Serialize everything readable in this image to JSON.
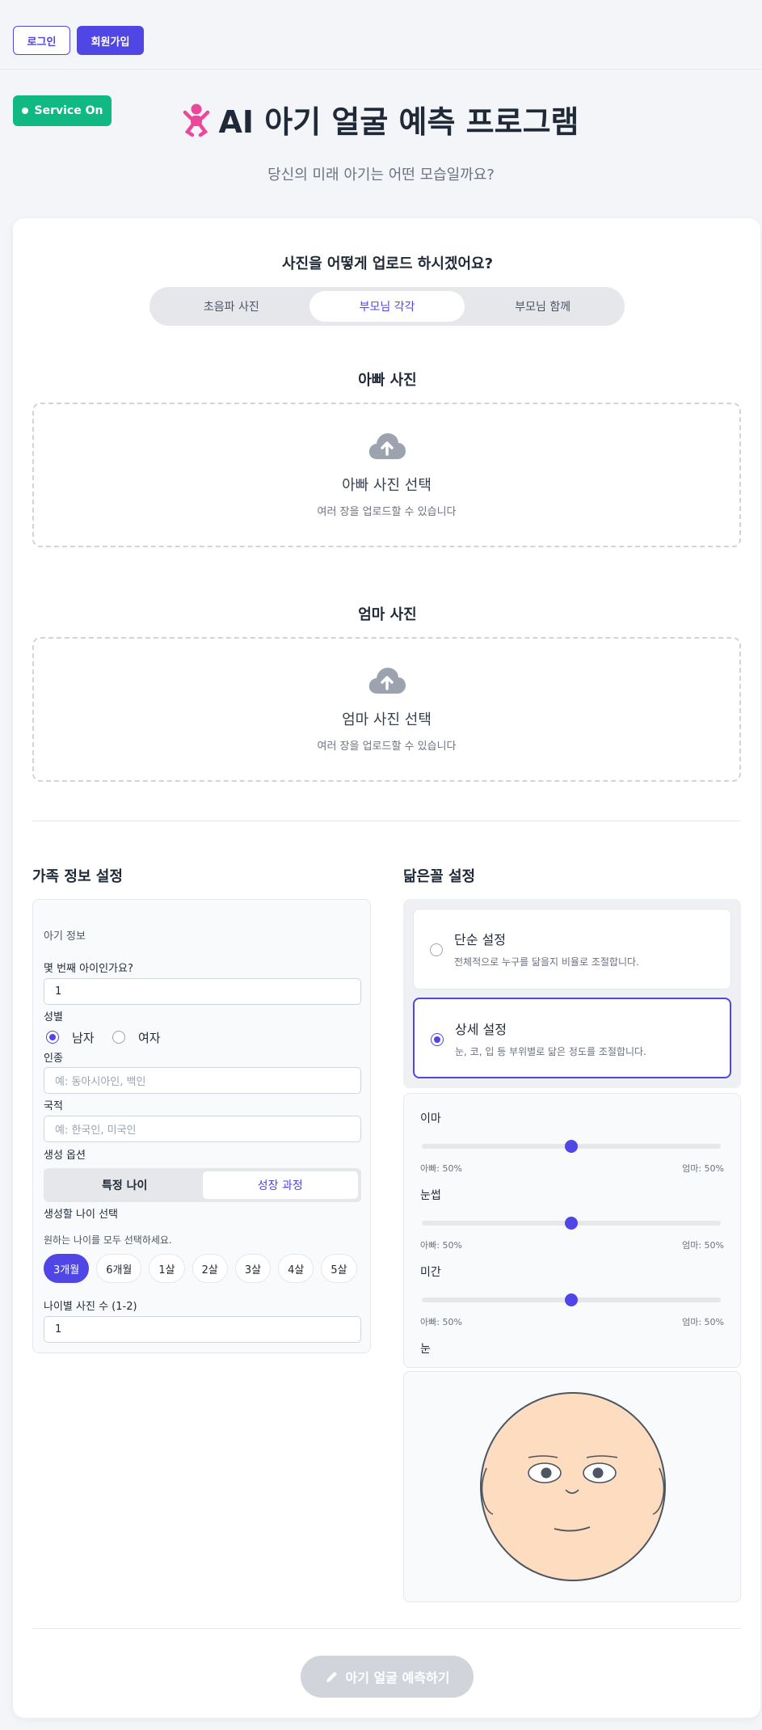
{
  "header": {
    "login_label": "로그인",
    "signup_label": "회원가입"
  },
  "service_status": "Service On",
  "title": "AI 아기 얼굴 예측 프로그램",
  "subtitle": "당신의 미래 아기는 어떤 모습일까요?",
  "upload": {
    "question": "사진을 어떻게 업로드 하시겠어요?",
    "tabs": [
      {
        "label": "초음파 사진",
        "active": false
      },
      {
        "label": "부모님 각각",
        "active": true
      },
      {
        "label": "부모님 함께",
        "active": false
      }
    ],
    "father": {
      "heading": "아빠 사진",
      "title": "아빠 사진 선택",
      "hint": "여러 장을 업로드할 수 있습니다"
    },
    "mother": {
      "heading": "엄마 사진",
      "title": "엄마 사진 선택",
      "hint": "여러 장을 업로드할 수 있습니다"
    }
  },
  "family": {
    "heading": "가족 정보 설정",
    "baby_info_label": "아기 정보",
    "birth_order_label": "몇 번째 아이인가요?",
    "birth_order_value": "1",
    "gender_label": "성별",
    "gender_options": [
      {
        "label": "남자",
        "selected": true
      },
      {
        "label": "여자",
        "selected": false
      }
    ],
    "ethnicity_label": "인종",
    "ethnicity_placeholder": "예: 동아시아인, 백인",
    "nationality_label": "국적",
    "nationality_placeholder": "예: 한국인, 미국인",
    "generation_label": "생성 옵션",
    "generation_options": [
      {
        "label": "특정 나이",
        "active": false
      },
      {
        "label": "성장 과정",
        "active": true
      }
    ],
    "age_select_label": "생성할 나이 선택",
    "age_select_hint": "원하는 나이를 모두 선택하세요.",
    "ages": [
      {
        "label": "3개월",
        "active": true
      },
      {
        "label": "6개월",
        "active": false
      },
      {
        "label": "1살",
        "active": false
      },
      {
        "label": "2살",
        "active": false
      },
      {
        "label": "3살",
        "active": false
      },
      {
        "label": "4살",
        "active": false
      },
      {
        "label": "5살",
        "active": false
      }
    ],
    "photos_per_age_label": "나이별 사진 수 (1-2)",
    "photos_per_age_value": "1"
  },
  "similarity": {
    "heading": "닮은꼴 설정",
    "options": [
      {
        "title": "단순 설정",
        "desc": "전체적으로 누구를 닮을지 비율로 조절합니다.",
        "selected": false
      },
      {
        "title": "상세 설정",
        "desc": "눈, 코, 입 등 부위별로 닮은 정도를 조절합니다.",
        "selected": true
      }
    ],
    "sliders": [
      {
        "label": "이마",
        "father": "아빠: 50%",
        "mother": "엄마: 50%",
        "value": 50
      },
      {
        "label": "눈썹",
        "father": "아빠: 50%",
        "mother": "엄마: 50%",
        "value": 50
      },
      {
        "label": "미간",
        "father": "아빠: 50%",
        "mother": "엄마: 50%",
        "value": 50
      }
    ],
    "next_label": "눈"
  },
  "predict_label": "아기 얼굴 예측하기",
  "colors": {
    "accent": "#4f46e5",
    "service": "#10b981",
    "baby_icon": "#ec4899",
    "face_skin": "#fddcbf"
  }
}
